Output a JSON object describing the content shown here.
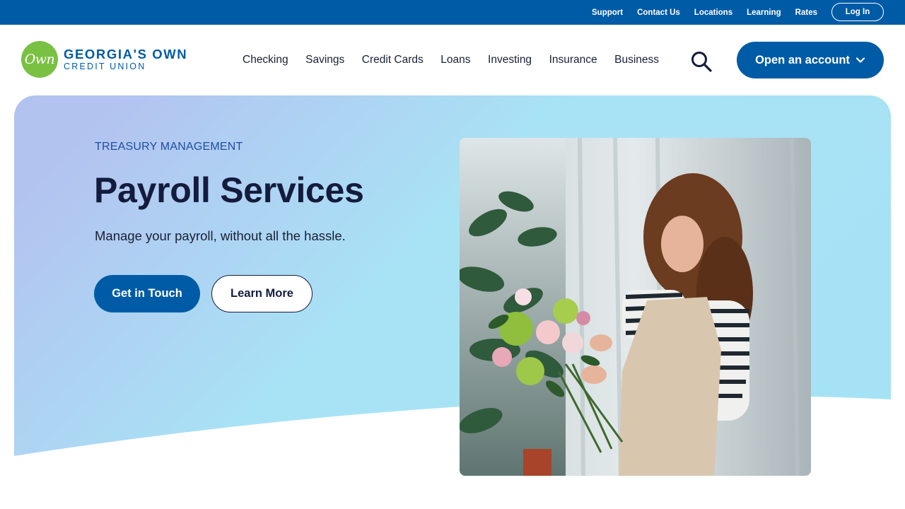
{
  "utility_nav": {
    "links": [
      "Support",
      "Contact Us",
      "Locations",
      "Learning",
      "Rates"
    ],
    "login_label": "Log In"
  },
  "header": {
    "logo": {
      "mark_text": "Own",
      "line1": "GEORGIA'S OWN",
      "line2": "CREDIT UNION"
    },
    "nav": [
      "Checking",
      "Savings",
      "Credit Cards",
      "Loans",
      "Investing",
      "Insurance",
      "Business"
    ],
    "search_icon": "search-icon",
    "cta_label": "Open an account"
  },
  "hero": {
    "eyebrow": "TREASURY MANAGEMENT",
    "title": "Payroll Services",
    "subtitle": "Manage your payroll, without all the hassle.",
    "primary_button": "Get in Touch",
    "secondary_button": "Learn More"
  },
  "colors": {
    "brand_blue": "#005ba6",
    "brand_green": "#7ac143",
    "heading": "#141b3d",
    "eyebrow": "#1f4ea3"
  }
}
